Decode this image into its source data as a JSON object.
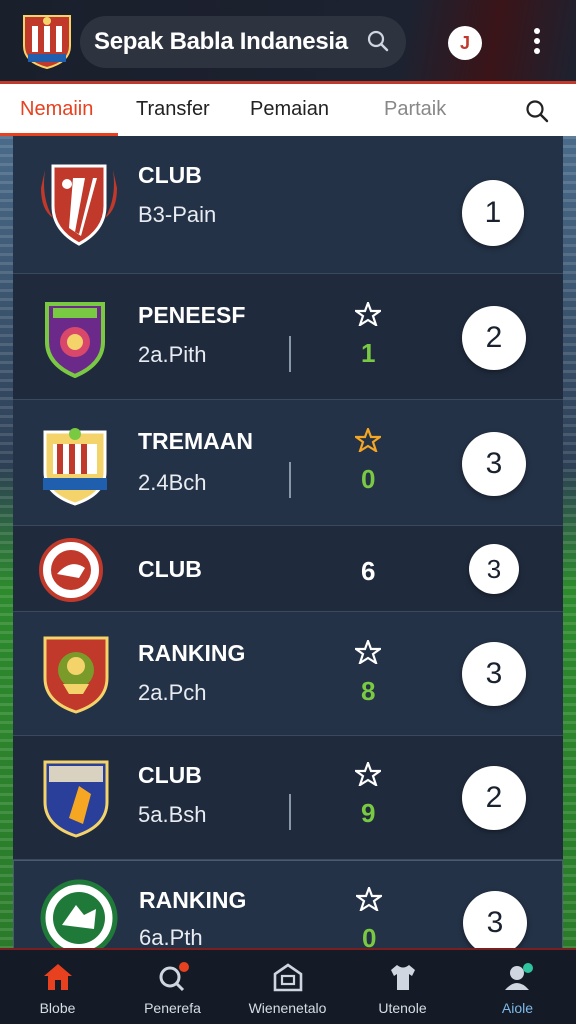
{
  "header": {
    "title": "Sepak Babla Indanesia",
    "user_initial": "J",
    "colors": {
      "accent": "#e8411f",
      "brand_red": "#c0392b"
    }
  },
  "tabs": [
    {
      "label": "Nemaiin",
      "active": true
    },
    {
      "label": "Transfer",
      "active": false
    },
    {
      "label": "Pemaian",
      "active": false
    },
    {
      "label": "Partaik",
      "active": false
    }
  ],
  "clubs": [
    {
      "name": "CLUB",
      "sub": "B3-Pain",
      "score": "",
      "score_color": "",
      "star_color": "",
      "rank": "1",
      "crest": "red-shield-crest"
    },
    {
      "name": "PENEESF",
      "sub": "2a.Pith",
      "score": "1",
      "score_color": "#7ac943",
      "star_color": "#ffffff",
      "rank": "2",
      "crest": "purple-shield-crest"
    },
    {
      "name": "TREMAAN",
      "sub": "2.4Bch",
      "score": "0",
      "score_color": "#7ac943",
      "star_color": "#f5a623",
      "rank": "3",
      "crest": "striped-crest"
    },
    {
      "name": "CLUB",
      "sub": "",
      "score": "6",
      "score_color": "#ffffff",
      "star_color": "",
      "rank": "3",
      "crest": "round-red-crest"
    },
    {
      "name": "RANKING",
      "sub": "2a.Pch",
      "score": "8",
      "score_color": "#7ac943",
      "star_color": "#ffffff",
      "rank": "3",
      "crest": "lion-crest"
    },
    {
      "name": "CLUB",
      "sub": "5a.Bsh",
      "score": "9",
      "score_color": "#7ac943",
      "star_color": "#ffffff",
      "rank": "2",
      "crest": "blue-shield-crest"
    },
    {
      "name": "RANKING",
      "sub": "6a.Pth",
      "score": "0",
      "score_color": "#7ac943",
      "star_color": "#ffffff",
      "rank": "3",
      "crest": "green-round-crest"
    }
  ],
  "bottom_nav": [
    {
      "label": "Blobe",
      "icon": "home-icon",
      "active": false
    },
    {
      "label": "Penerefa",
      "icon": "search-bell-icon",
      "active": false
    },
    {
      "label": "Wienenetalo",
      "icon": "stadium-icon",
      "active": false
    },
    {
      "label": "Utenole",
      "icon": "shirt-icon",
      "active": false
    },
    {
      "label": "Aiole",
      "icon": "profile-icon",
      "active": true
    }
  ]
}
